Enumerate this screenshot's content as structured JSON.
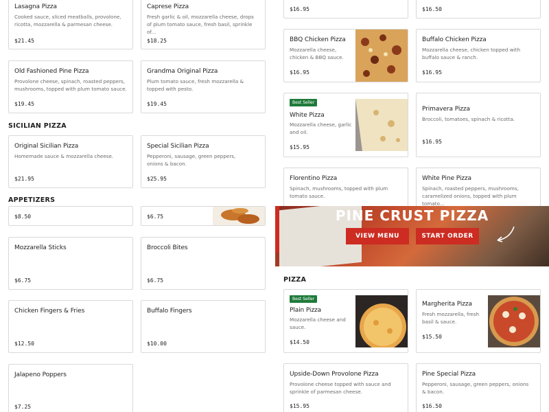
{
  "sections": {
    "sicilian": "SICILIAN PIZZA",
    "appetizers": "APPETIZERS",
    "pizza": "PIZZA"
  },
  "left": {
    "lasagna": {
      "name": "Lasagna Pizza",
      "desc": "Cooked sauce, sliced meatballs, provolone, ricotta, mozzarella & parmesan cheese.",
      "price": "$21.45"
    },
    "caprese": {
      "name": "Caprese Pizza",
      "desc": "Fresh garlic & oil, mozzarella cheese, drops of plum tomato sauce, fresh basil, sprinkle of...",
      "price": "$18.25"
    },
    "old_fashioned": {
      "name": "Old Fashioned Pine Pizza",
      "desc": "Provolone cheese, spinach, roasted peppers, mushrooms, topped with plum tomato sauce.",
      "price": "$19.45"
    },
    "grandma": {
      "name": "Grandma Original Pizza",
      "desc": "Plum tomato sauce, fresh mozzarella & topped with pesto.",
      "price": "$19.45"
    },
    "orig_sicilian": {
      "name": "Original Sicilian Pizza",
      "desc": "Homemade sauce & mozzarella cheese.",
      "price": "$21.95"
    },
    "special_sicilian": {
      "name": "Special Sicilian Pizza",
      "desc": "Pepperoni, sausage, green peppers, onions & bacon.",
      "price": "$25.95"
    },
    "app1": {
      "price": "$8.50"
    },
    "app2": {
      "price": "$6.75"
    },
    "mozz_sticks": {
      "name": "Mozzarella Sticks",
      "price": "$6.75"
    },
    "broccoli": {
      "name": "Broccoli Bites",
      "price": "$6.75"
    },
    "chicken_fingers": {
      "name": "Chicken Fingers & Fries",
      "price": "$12.50"
    },
    "buffalo_fingers": {
      "name": "Buffalo Fingers",
      "price": "$10.00"
    },
    "jalapeno": {
      "name": "Jalapeno Poppers",
      "price": "$7.25"
    }
  },
  "right": {
    "top_a": {
      "price": "$16.95"
    },
    "top_b": {
      "price": "$16.50"
    },
    "bbq": {
      "name": "BBQ Chicken Pizza",
      "desc": "Mozzarella cheese, chicken & BBQ sauce.",
      "price": "$16.95"
    },
    "buffalo_chicken": {
      "name": "Buffalo Chicken Pizza",
      "desc": "Mozzarella cheese, chicken topped with buffalo sauce & ranch.",
      "price": "$16.95"
    },
    "white": {
      "badge": "Best Seller",
      "name": "White Pizza",
      "desc": "Mozzarella cheese, garlic and oil.",
      "price": "$15.95"
    },
    "primavera": {
      "name": "Primavera Pizza",
      "desc": "Broccoli, tomatoes, spinach & ricotta.",
      "price": "$16.95"
    },
    "florentino": {
      "name": "Florentino Pizza",
      "desc": "Spinach, mushrooms, topped with plum tomato sauce."
    },
    "white_pine": {
      "name": "White Pine Pizza",
      "desc": "Spinach, roasted peppers, mushrooms, caramelized onions, topped with plum tomato..."
    },
    "plain": {
      "badge": "Best Seller",
      "name": "Plain Pizza",
      "desc": "Mozzarella cheese and sauce.",
      "price": "$14.50"
    },
    "margherita": {
      "name": "Margherita Pizza",
      "desc": "Fresh mozzarella, fresh basil & sauce.",
      "price": "$15.50"
    },
    "upside_down": {
      "name": "Upside-Down Provolone Pizza",
      "desc": "Provolone cheese topped with sauce and sprinkle of parmesan cheese.",
      "price": "$15.95"
    },
    "pine_special": {
      "name": "Pine Special Pizza",
      "desc": "Pepperoni, sausage, green peppers, onions & bacon.",
      "price": "$16.50"
    }
  },
  "banner": {
    "headline": "PINE CRUST PIZZA",
    "view_menu": "VIEW MENU",
    "start_order": "START ORDER"
  },
  "icons": {
    "arrow": "curved-arrow-icon"
  },
  "colors": {
    "accent_red": "#cc2c22",
    "best_seller_green": "#1f7a3a",
    "card_border": "#d9d9d9"
  }
}
